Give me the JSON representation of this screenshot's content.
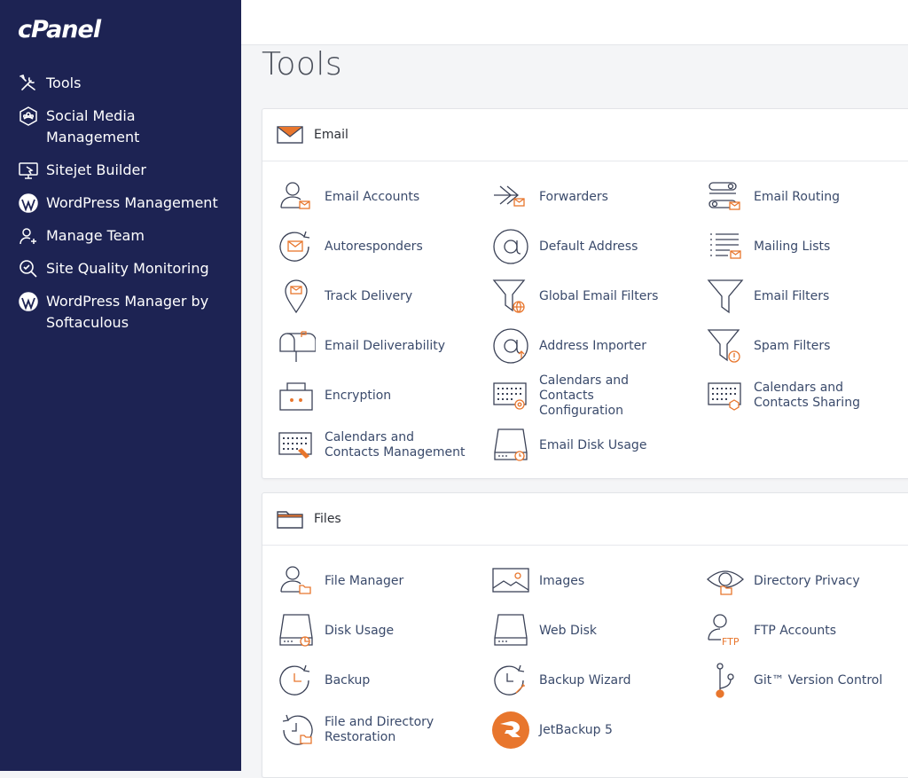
{
  "brand": {
    "logo": "cPanel",
    "accent": "#e8762d",
    "sidebar_bg": "#1d2353",
    "icon_stroke": "#3b4257"
  },
  "sidebar": {
    "items": [
      {
        "label": "Tools",
        "icon": "tools-icon"
      },
      {
        "label": "Social Media Management",
        "icon": "social-media-icon"
      },
      {
        "label": "Sitejet Builder",
        "icon": "sitejet-icon"
      },
      {
        "label": "WordPress Management",
        "icon": "wordpress-icon"
      },
      {
        "label": "Manage Team",
        "icon": "add-user-icon"
      },
      {
        "label": "Site Quality Monitoring",
        "icon": "magnifier-icon"
      },
      {
        "label": "WordPress Manager by Softaculous",
        "icon": "wordpress-icon"
      }
    ]
  },
  "page": {
    "title": "Tools"
  },
  "email": {
    "title": "Email",
    "items": [
      {
        "label": "Email Accounts"
      },
      {
        "label": "Forwarders"
      },
      {
        "label": "Email Routing"
      },
      {
        "label": "Autoresponders"
      },
      {
        "label": "Default Address"
      },
      {
        "label": "Mailing Lists"
      },
      {
        "label": "Track Delivery"
      },
      {
        "label": "Global Email Filters"
      },
      {
        "label": "Email Filters"
      },
      {
        "label": "Email Deliverability"
      },
      {
        "label": "Address Importer"
      },
      {
        "label": "Spam Filters"
      },
      {
        "label": "Encryption"
      },
      {
        "label": "Calendars and Contacts Configuration"
      },
      {
        "label": "Calendars and Contacts Sharing"
      },
      {
        "label": "Calendars and Contacts Management"
      },
      {
        "label": "Email Disk Usage"
      }
    ]
  },
  "files": {
    "title": "Files",
    "items": [
      {
        "label": "File Manager"
      },
      {
        "label": "Images"
      },
      {
        "label": "Directory Privacy"
      },
      {
        "label": "Disk Usage"
      },
      {
        "label": "Web Disk"
      },
      {
        "label": "FTP Accounts"
      },
      {
        "label": "Backup"
      },
      {
        "label": "Backup Wizard"
      },
      {
        "label": "Git™ Version Control"
      },
      {
        "label": "File and Directory Restoration"
      },
      {
        "label": "JetBackup 5"
      }
    ]
  }
}
